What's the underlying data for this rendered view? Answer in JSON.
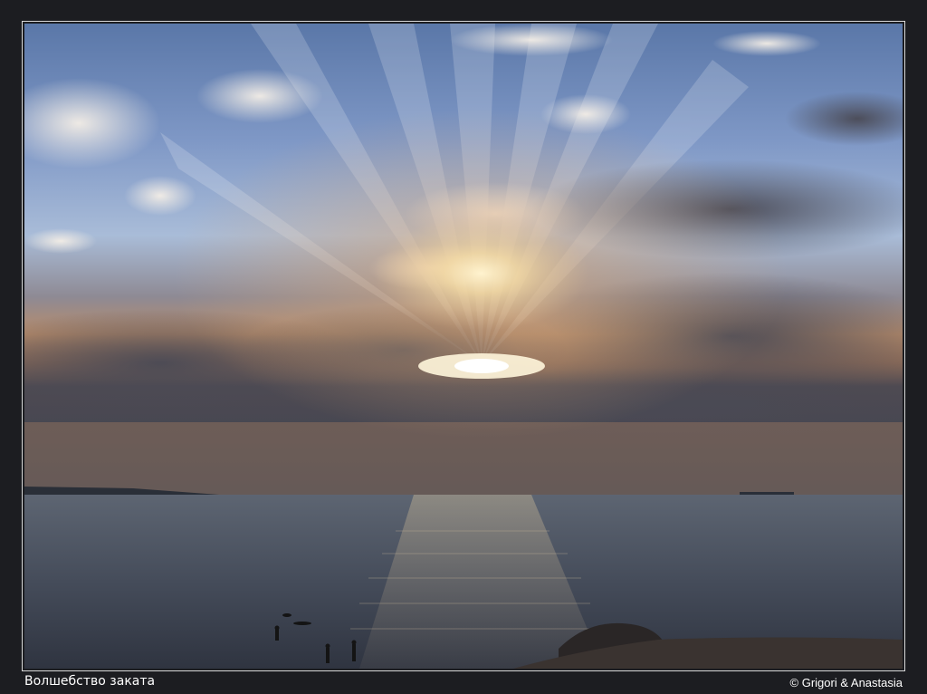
{
  "caption": {
    "title": "Волшебство заката",
    "copyright": "© Grigori & Anastasia"
  },
  "colors": {
    "frame": "#1c1d21",
    "border": "#d9d9d9",
    "sky_top": "#5a77a8",
    "sky_mid": "#9fb6d6",
    "sunset_glow": "#e8c184",
    "sea": "#434a57"
  }
}
